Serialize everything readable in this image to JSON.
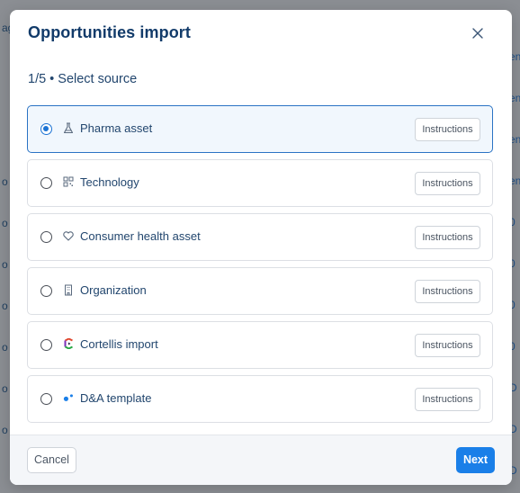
{
  "background": {
    "left_fragments": [
      "ag",
      "o",
      "o",
      "o",
      "o",
      "o",
      "o",
      "o"
    ],
    "right_fragments": [
      "en",
      "en",
      "en",
      "en",
      "0",
      "0",
      "0",
      "0",
      "D",
      "D",
      "D",
      "D"
    ]
  },
  "modal": {
    "title": "Opportunities import",
    "step": "1/5 • Select source",
    "options": [
      {
        "label": "Pharma asset",
        "icon": "flask-icon",
        "selected": true,
        "instructions": "Instructions"
      },
      {
        "label": "Technology",
        "icon": "qr-grid-icon",
        "selected": false,
        "instructions": "Instructions"
      },
      {
        "label": "Consumer health asset",
        "icon": "heart-icon",
        "selected": false,
        "instructions": "Instructions"
      },
      {
        "label": "Organization",
        "icon": "building-icon",
        "selected": false,
        "instructions": "Instructions"
      },
      {
        "label": "Cortellis import",
        "icon": "cortellis-logo-icon",
        "selected": false,
        "instructions": "Instructions"
      },
      {
        "label": "D&A template",
        "icon": "dots-icon",
        "selected": false,
        "instructions": "Instructions"
      }
    ],
    "footer": {
      "cancel_label": "Cancel",
      "next_label": "Next"
    }
  },
  "colors": {
    "accent": "#1a7fe8",
    "title": "#123b6a",
    "selected_border": "#2a73c4"
  }
}
